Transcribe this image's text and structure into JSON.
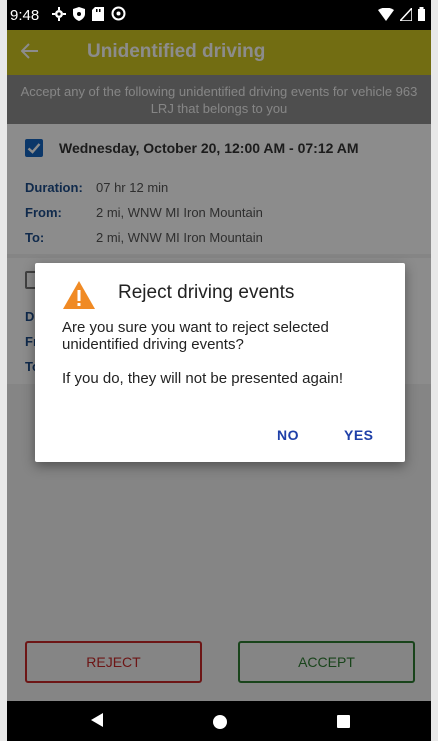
{
  "status_bar": {
    "time": "9:48"
  },
  "app_bar": {
    "title": "Unidentified driving"
  },
  "subheader": {
    "text": "Accept any of the following unidentified driving events for vehicle 963 LRJ that belongs to you"
  },
  "events": [
    {
      "title": "Wednesday, October 20, 12:00 AM - 07:12 AM",
      "checked": true,
      "duration_label": "Duration:",
      "duration": "07 hr  12 min",
      "from_label": "From:",
      "from": "2 mi, WNW MI Iron Mountain",
      "to_label": "To:",
      "to": "2 mi, WNW MI Iron Mountain"
    },
    {
      "title": "",
      "checked": false,
      "duration_label": "D",
      "from_label": "Fr",
      "to_label": "To"
    }
  ],
  "dialog": {
    "title": "Reject driving events",
    "message": "Are you sure you want to reject selected unidentified driving events?",
    "message2": "If you do, they will not be presented again!",
    "no_label": "NO",
    "yes_label": "YES"
  },
  "actions": {
    "reject_label": "REJECT",
    "accept_label": "ACCEPT"
  },
  "colors": {
    "app_bar": "#cfc621",
    "reject": "#c62828",
    "accept": "#2e7d32",
    "dialog_button": "#1e3fa8",
    "warning": "#f08a24"
  }
}
